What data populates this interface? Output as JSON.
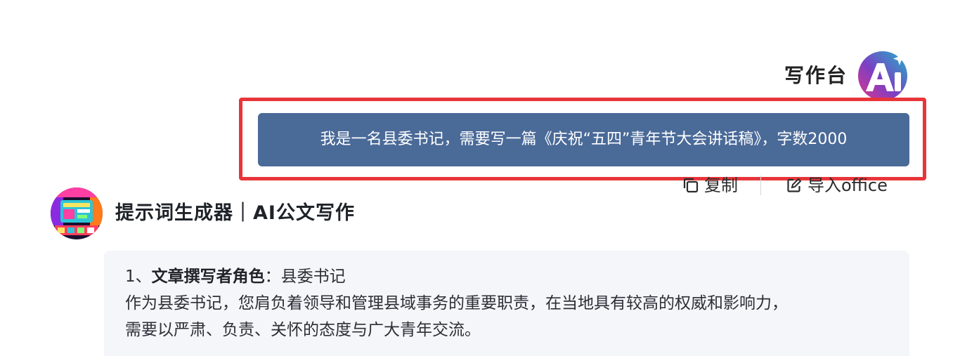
{
  "user": {
    "name": "写作台",
    "avatar_icon": "ai-logo-icon",
    "message": "我是一名县委书记，需要写一篇《庆祝“五四”青年节大会讲话稿》，字数2000"
  },
  "actions": {
    "copy_label": "复制",
    "copy_icon": "copy-icon",
    "import_label": "导入office",
    "import_icon": "edit-icon"
  },
  "bot": {
    "name": "提示词生成器｜AI公文写作",
    "avatar_icon": "bot-avatar-image"
  },
  "response": {
    "role_index": "1、",
    "role_title": "文章撰写者角色",
    "role_sep": "：",
    "role_value": "县委书记",
    "paragraph_1": "作为县委书记，您肩负着领导和管理县域事务的重要职责，在当地具有较高的权威和影响力，",
    "paragraph_2": "需要以严肃、负责、关怀的态度与广大青年交流。"
  },
  "colors": {
    "bubble": "#4a6a98",
    "highlight": "#e8353a",
    "card": "#f4f6f9"
  }
}
